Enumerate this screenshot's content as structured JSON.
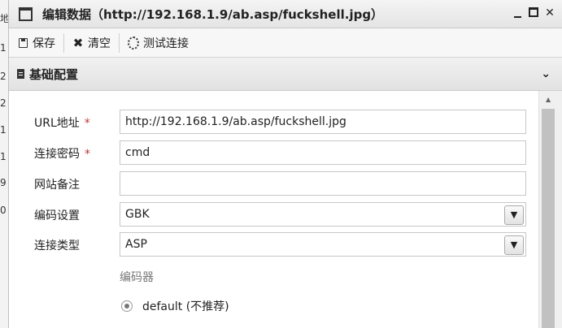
{
  "background_strip": [
    "地",
    "1",
    "2",
    "2",
    "1",
    "1",
    "9",
    "0"
  ],
  "window": {
    "title": "编辑数据（http://192.168.1.9/ab.asp/fuckshell.jpg）",
    "controls": {
      "min": "_",
      "max": "□",
      "close": "✕"
    }
  },
  "toolbar": {
    "save_label": "保存",
    "clear_label": "清空",
    "test_label": "测试连接"
  },
  "section": {
    "title": "基础配置"
  },
  "form": {
    "url_label": "URL地址",
    "url_value": "http://192.168.1.9/ab.asp/fuckshell.jpg",
    "password_label": "连接密码",
    "password_value": "cmd",
    "note_label": "网站备注",
    "note_value": "",
    "encoding_label": "编码设置",
    "encoding_value": "GBK",
    "type_label": "连接类型",
    "type_value": "ASP",
    "required_mark": "*",
    "encoder_label": "编码器",
    "encoder_option": "default (不推荐)"
  },
  "colors": {
    "required": "#d62a2a",
    "titlebar": "#e8e8e8"
  }
}
